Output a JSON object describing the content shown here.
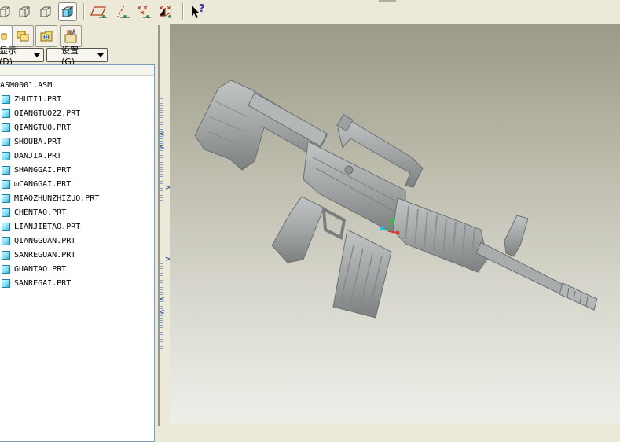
{
  "toolbar": {
    "icons": [
      "display-wireframe-icon",
      "hidden-line-icon",
      "no-hidden-icon",
      "shaded-icon",
      "datum-plane-icon",
      "datum-axis-icon",
      "datum-point-icon",
      "coordinate-system-icon",
      "context-help-icon"
    ],
    "active": "shaded-icon",
    "help_glyph": "?"
  },
  "panel": {
    "tabs": [
      "model-tree-tab",
      "folder-browser-tab",
      "favorites-tab",
      "connections-tab"
    ],
    "display_button": "显示 (D)",
    "settings_button": "设置 (G)"
  },
  "tree": {
    "root": "ASM0001.ASM",
    "items": [
      "ZHUTI1.PRT",
      "QIANGTUO22.PRT",
      "QIANGTUO.PRT",
      "SHOUBA.PRT",
      "DANJIA.PRT",
      "SHANGGAI.PRT",
      "⊡CANGGAI.PRT",
      "MIAOZHUNZHIZUO.PRT",
      "CHENTAO.PRT",
      "LIANJIETAO.PRT",
      "QIANGGUAN.PRT",
      "SANREGUAN.PRT",
      "GUANTAO.PRT",
      "SANREGAI.PRT"
    ]
  },
  "viewport": {
    "model": "M4 carbine assembly, shaded",
    "colors": {
      "model": "#a3a6a6",
      "model_dark": "#6c7070",
      "axis_x": "#e03030",
      "axis_y": "#30c040",
      "axis_z": "#20c0e0"
    }
  }
}
